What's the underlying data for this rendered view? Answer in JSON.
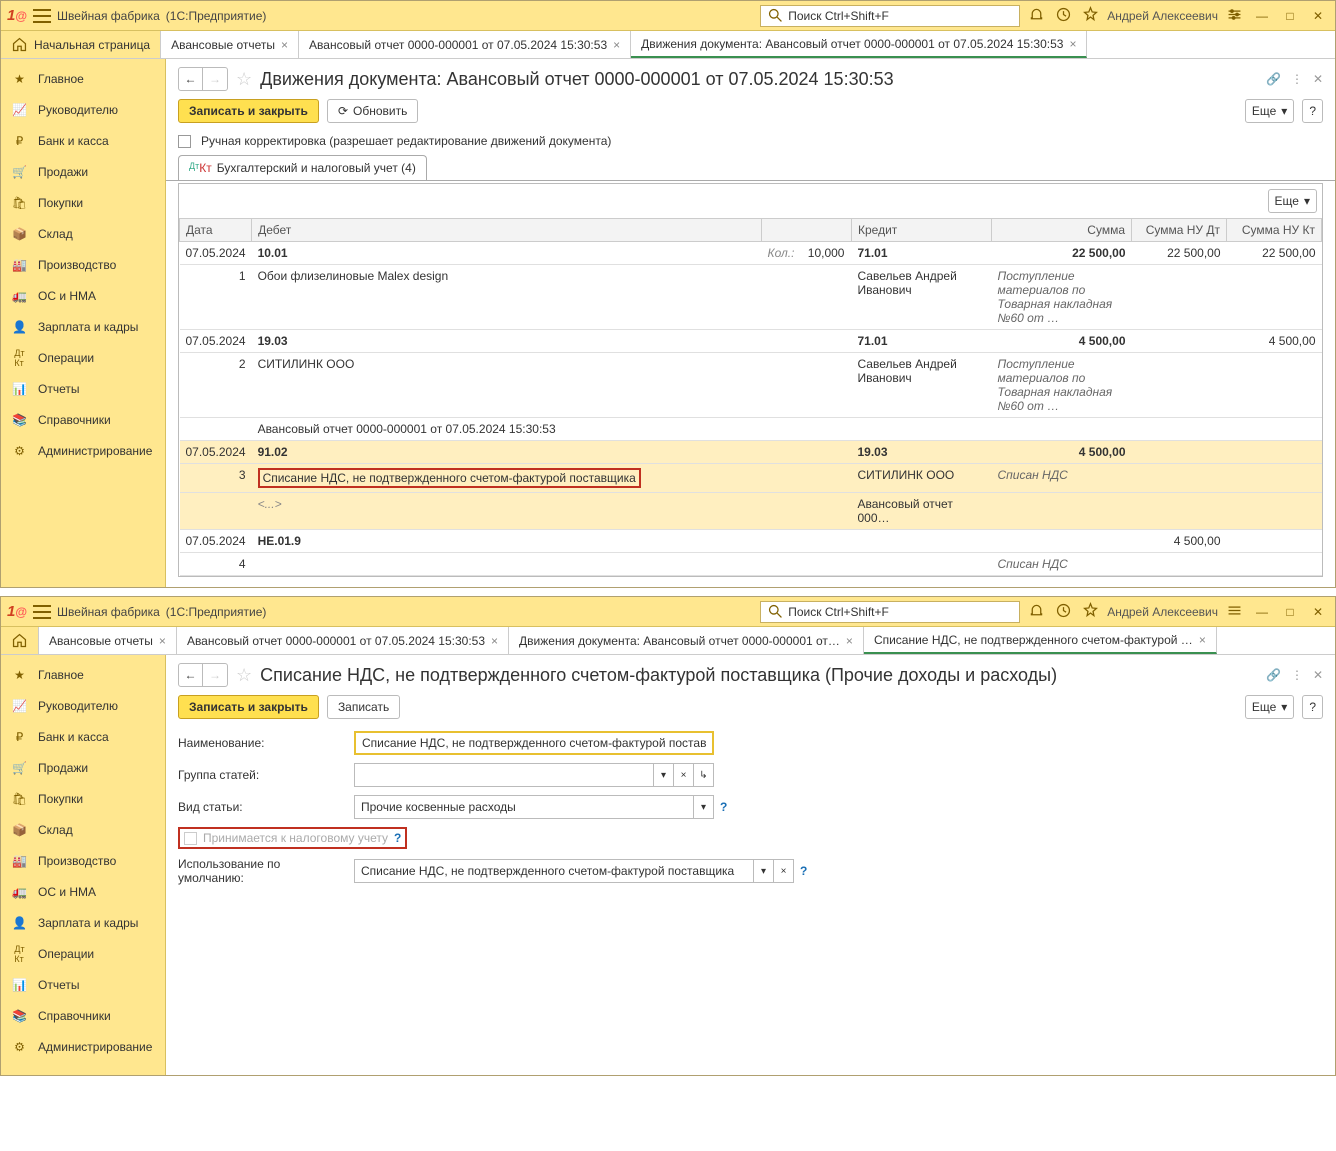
{
  "app": {
    "company": "Швейная фабрика",
    "platform": "(1С:Предприятие)",
    "search_placeholder": "Поиск Ctrl+Shift+F",
    "user": "Андрей Алексеевич"
  },
  "sidebar": [
    {
      "id": "main",
      "label": "Главное"
    },
    {
      "id": "manager",
      "label": "Руководителю"
    },
    {
      "id": "bank",
      "label": "Банк и касса"
    },
    {
      "id": "sales",
      "label": "Продажи"
    },
    {
      "id": "purchases",
      "label": "Покупки"
    },
    {
      "id": "stock",
      "label": "Склад"
    },
    {
      "id": "production",
      "label": "Производство"
    },
    {
      "id": "os",
      "label": "ОС и НМА"
    },
    {
      "id": "salary",
      "label": "Зарплата и кадры"
    },
    {
      "id": "operations",
      "label": "Операции"
    },
    {
      "id": "reports",
      "label": "Отчеты"
    },
    {
      "id": "refs",
      "label": "Справочники"
    },
    {
      "id": "admin",
      "label": "Администрирование"
    }
  ],
  "win1": {
    "tabs": [
      {
        "label": "Начальная страница",
        "home": true
      },
      {
        "label": "Авансовые отчеты"
      },
      {
        "label": "Авансовый отчет 0000-000001 от 07.05.2024 15:30:53"
      },
      {
        "label": "Движения документа: Авансовый отчет 0000-000001 от 07.05.2024 15:30:53",
        "active": true
      }
    ],
    "page_title": "Движения документа: Авансовый отчет 0000-000001 от 07.05.2024 15:30:53",
    "btn_save": "Записать и закрыть",
    "btn_refresh": "Обновить",
    "btn_more": "Еще",
    "manual_label": "Ручная корректировка (разрешает редактирование движений документа)",
    "subtab": "Бухгалтерский и налоговый учет (4)",
    "cols": {
      "date": "Дата",
      "debit": "Дебет",
      "credit": "Кредит",
      "sum": "Сумма",
      "sum_dt": "Сумма НУ Дт",
      "sum_kt": "Сумма НУ Кт",
      "qty": "Кол.:"
    },
    "rows": [
      {
        "n": "1",
        "date": "07.05.2024",
        "debit_acc": "10.01",
        "debit_txt": "Обои флизелиновые Malex design",
        "qty": "10,000",
        "credit_acc": "71.01",
        "credit_txt": "Савельев Андрей Иванович",
        "sum": "22 500,00",
        "note": "Поступление материалов по Товарная накладная №60 от …",
        "sum_dt": "22 500,00",
        "sum_kt": "22 500,00"
      },
      {
        "n": "2",
        "date": "07.05.2024",
        "debit_acc": "19.03",
        "debit_txt": "СИТИЛИНК ООО",
        "debit_sub": "Авансовый отчет 0000-000001 от 07.05.2024 15:30:53",
        "credit_acc": "71.01",
        "credit_txt": "Савельев Андрей Иванович",
        "sum": "4 500,00",
        "note": "Поступление материалов по Товарная накладная №60 от …",
        "sum_kt": "4 500,00"
      },
      {
        "n": "3",
        "date": "07.05.2024",
        "debit_acc": "91.02",
        "debit_txt": "Списание НДС, не подтвержденного счетом-фактурой поставщика",
        "debit_sub": "<...>",
        "credit_acc": "19.03",
        "credit_txt": "СИТИЛИНК ООО",
        "credit_sub": "Авансовый отчет 000…",
        "sum": "4 500,00",
        "note": "Списан НДС",
        "hl": true
      },
      {
        "n": "4",
        "date": "07.05.2024",
        "debit_acc": "НЕ.01.9",
        "sum_dt": "4 500,00",
        "note": "Списан НДС"
      }
    ]
  },
  "win2": {
    "tabs": [
      {
        "label": "Авансовые отчеты"
      },
      {
        "label": "Авансовый отчет 0000-000001 от 07.05.2024 15:30:53"
      },
      {
        "label": "Движения документа: Авансовый отчет 0000-000001 от…"
      },
      {
        "label": "Списание НДС, не подтвержденного счетом-фактурой …",
        "active": true
      }
    ],
    "page_title": "Списание НДС, не подтвержденного счетом-фактурой поставщика (Прочие доходы и расходы)",
    "btn_save": "Записать и закрыть",
    "btn_write": "Записать",
    "btn_more": "Еще",
    "form": {
      "name_label": "Наименование:",
      "name_value": "Списание НДС, не подтвержденного счетом-фактурой поставщика",
      "group_label": "Группа статей:",
      "type_label": "Вид статьи:",
      "type_value": "Прочие косвенные расходы",
      "tax_label": "Принимается к налоговому учету",
      "default_label": "Использование по умолчанию:",
      "default_value": "Списание НДС, не подтвержденного счетом-фактурой поставщика"
    }
  }
}
